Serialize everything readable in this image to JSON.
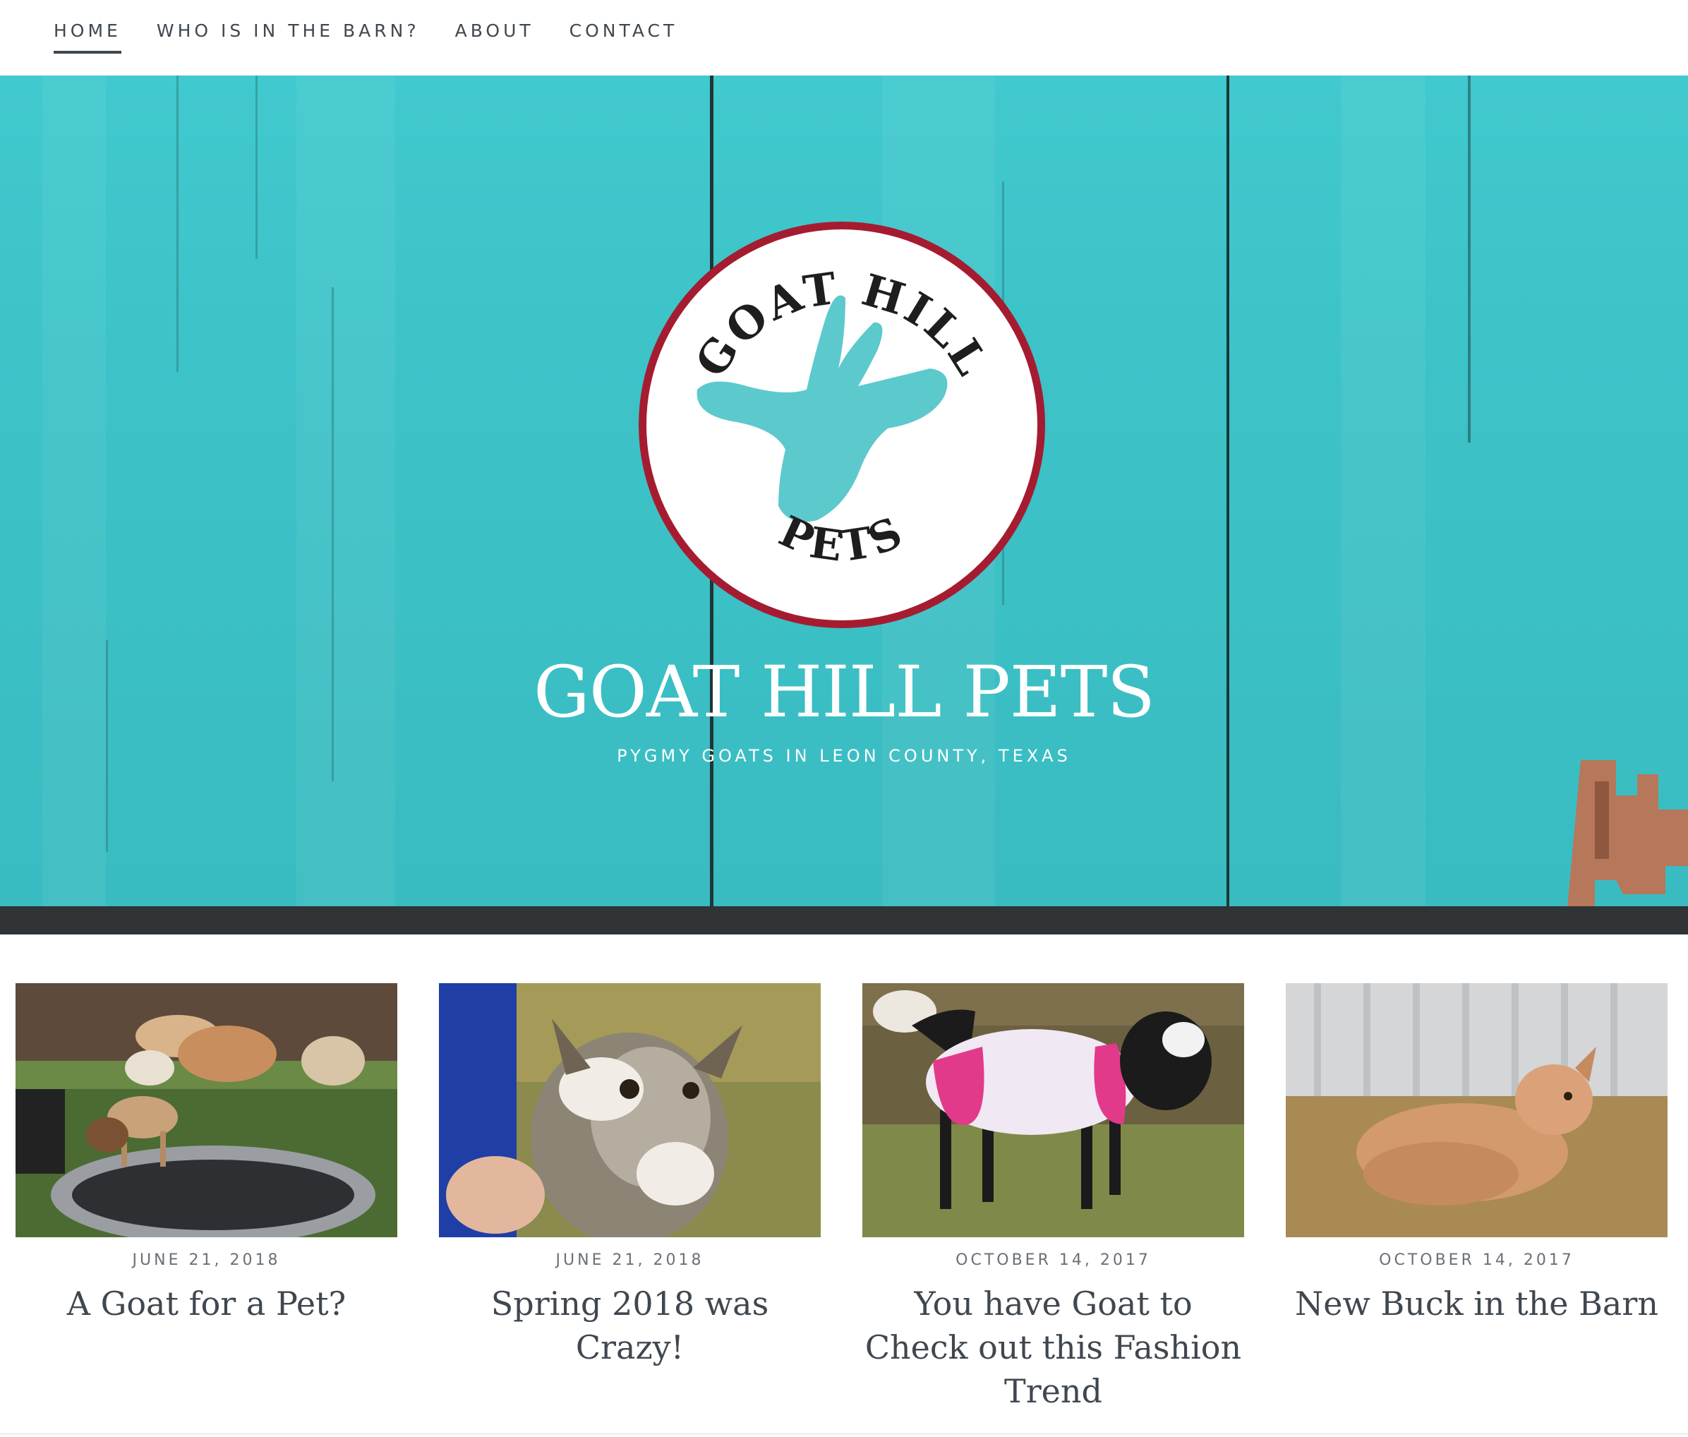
{
  "nav": {
    "items": [
      {
        "label": "HOME",
        "active": true
      },
      {
        "label": "WHO IS IN THE BARN?",
        "active": false
      },
      {
        "label": "ABOUT",
        "active": false
      },
      {
        "label": "CONTACT",
        "active": false
      }
    ]
  },
  "hero": {
    "logo_text_top": "GOAT HILL",
    "logo_text_bottom": "PETS",
    "title": "GOAT HILL PETS",
    "tagline": "PYGMY GOATS IN LEON COUNTY, TEXAS",
    "background_color": "#3fc6cb",
    "logo_ring_color": "#a51c30",
    "goat_color": "#5cc9cd"
  },
  "posts": [
    {
      "date": "JUNE 21, 2018",
      "title": "A Goat for a Pet?"
    },
    {
      "date": "JUNE 21, 2018",
      "title": "Spring 2018 was Crazy!"
    },
    {
      "date": "OCTOBER 14, 2017",
      "title": "You have Goat to Check out this Fashion Trend"
    },
    {
      "date": "OCTOBER 14, 2017",
      "title": "New Buck in the Barn"
    }
  ]
}
